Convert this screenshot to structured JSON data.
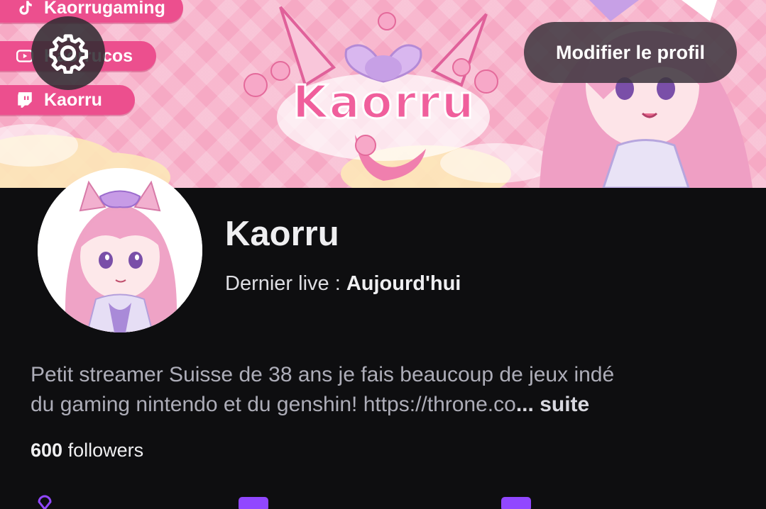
{
  "banner": {
    "logo_text": "Kaorru",
    "socials": [
      {
        "icon": "tiktok-icon",
        "label": "Kaorrugaming"
      },
      {
        "icon": "youtube-icon",
        "label": "Kaorrucos"
      },
      {
        "icon": "twitch-icon",
        "label": "Kaorru"
      }
    ]
  },
  "header": {
    "settings_icon": "gear-icon",
    "edit_profile_label": "Modifier le profil"
  },
  "profile": {
    "channel_name": "Kaorru",
    "last_live_label": "Dernier live :",
    "last_live_value": "Aujourd'hui",
    "bio_line1": "Petit streamer Suisse de 38 ans je fais beaucoup de jeux indé",
    "bio_line2": "du gaming nintendo  et du genshin! https://throne.co",
    "bio_ellipsis": "...",
    "bio_more": "suite",
    "followers_count": "600",
    "followers_label": "followers"
  },
  "colors": {
    "background": "#0e0e10",
    "accent": "#9147ff",
    "banner_pink": "#ec4f8e"
  }
}
